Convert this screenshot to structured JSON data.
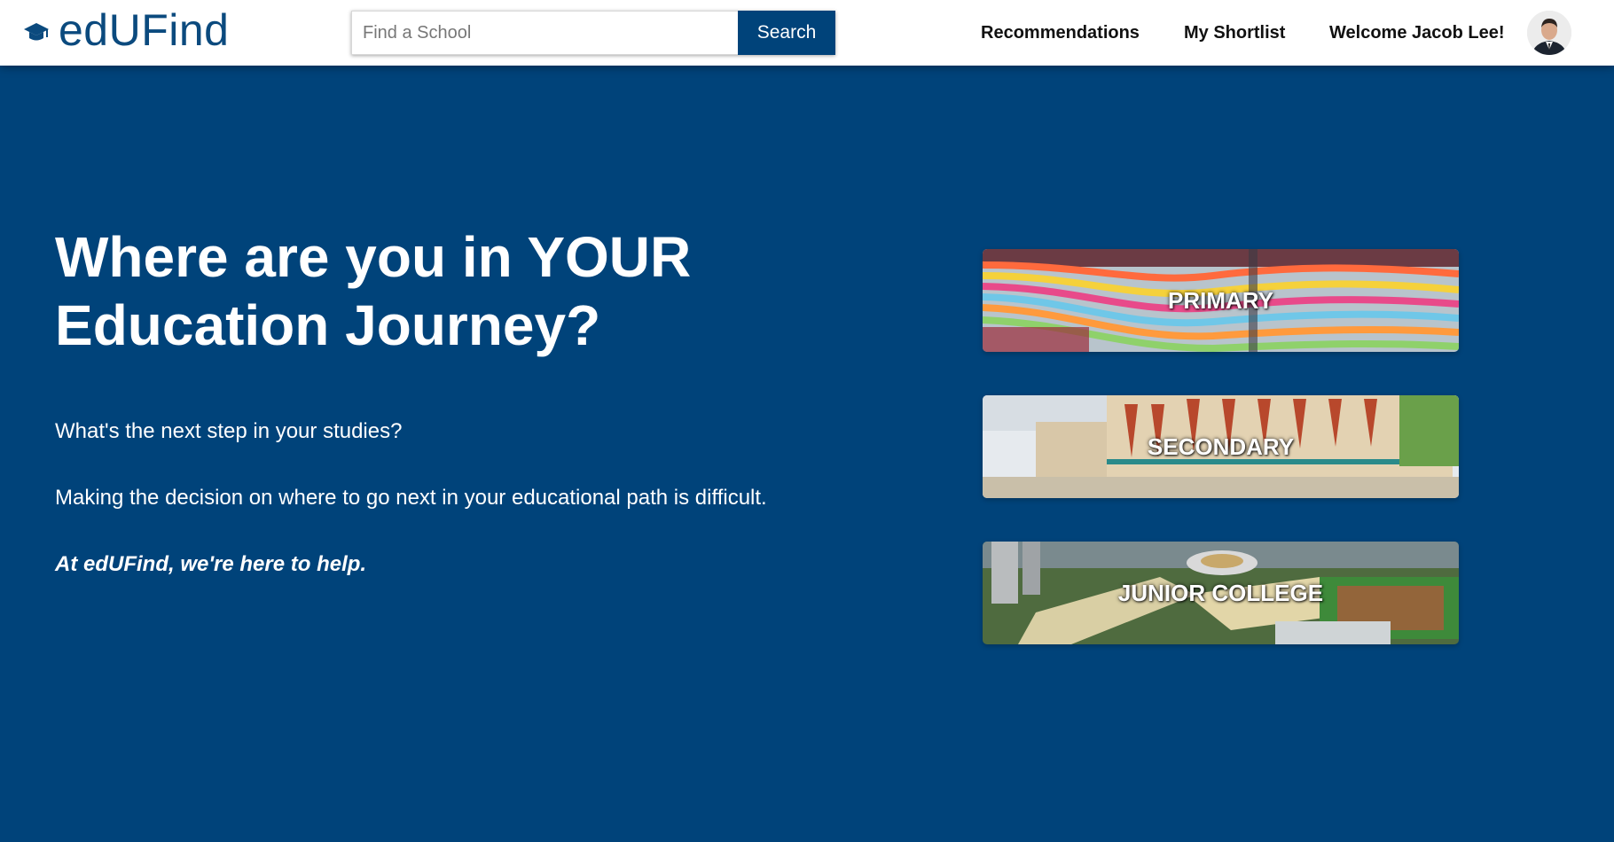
{
  "header": {
    "logo_text": "edUFind",
    "logo_icon": "graduation-cap-icon",
    "search": {
      "placeholder": "Find a School",
      "value": "",
      "button_label": "Search"
    },
    "nav": {
      "recommendations": "Recommendations",
      "shortlist": "My Shortlist",
      "welcome": "Welcome Jacob Lee!"
    }
  },
  "hero": {
    "title_line1": "Where are you in YOUR",
    "title_line2": "Education Journey?",
    "paragraph1": "What's the next step in your studies?",
    "paragraph2": "Making the decision on where to go next in your educational path is difficult.",
    "paragraph3": "At edUFind, we're here to help."
  },
  "levels": [
    {
      "label": "PRIMARY"
    },
    {
      "label": "SECONDARY"
    },
    {
      "label": "JUNIOR COLLEGE"
    }
  ],
  "colors": {
    "brand": "#00437a",
    "header_bg": "#ffffff",
    "text_on_brand": "#ffffff"
  }
}
